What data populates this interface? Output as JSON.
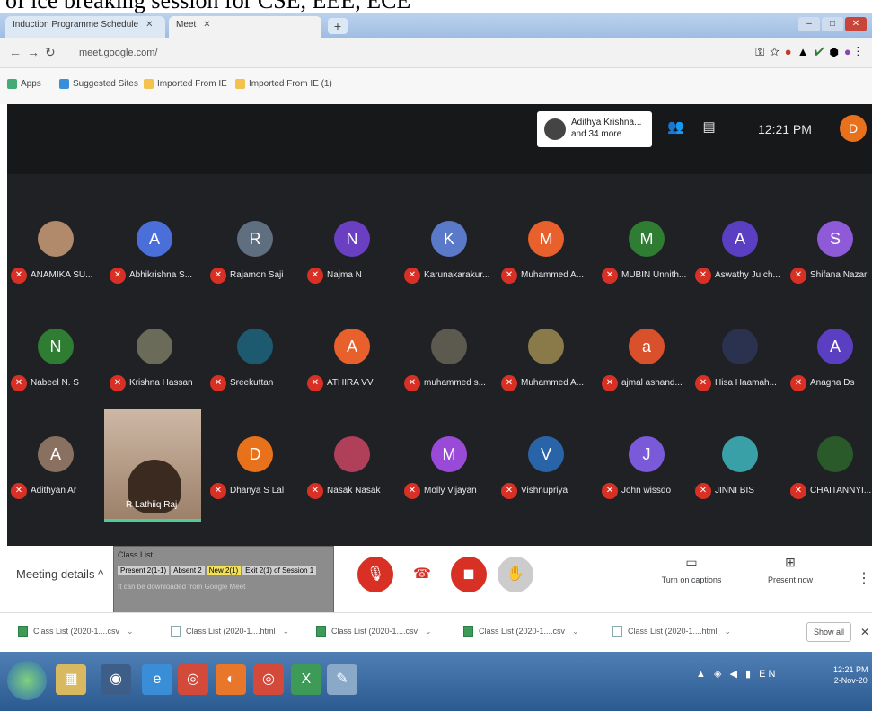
{
  "caption": "of ice breaking session for CSE, EEE, ECE",
  "browser": {
    "tabs": [
      {
        "label": "Induction Programme Schedule",
        "active": false
      },
      {
        "label": "Meet",
        "active": true
      }
    ],
    "address": "meet.google.com/",
    "bookmarks": [
      {
        "label": "Apps",
        "color": "#4a7"
      },
      {
        "label": "Suggested Sites",
        "color": "#3a8ed8"
      },
      {
        "label": "Imported From IE",
        "color": "#f2c14e"
      },
      {
        "label": "Imported From IE (1)",
        "color": "#f2c14e"
      }
    ]
  },
  "meet": {
    "participants_label": "Adithya Krishna... and 34 more",
    "time": "12:21 PM",
    "self_initial": "D",
    "participants": [
      {
        "name": "ANAMIKA SU...",
        "initial": "",
        "color": "#b08a6a",
        "photo": true
      },
      {
        "name": "Abhikrishna S...",
        "initial": "A",
        "color": "#4a6fd8"
      },
      {
        "name": "Rajamon Saji",
        "initial": "R",
        "color": "#5f6f80"
      },
      {
        "name": "Najma N",
        "initial": "N",
        "color": "#6a3fc2"
      },
      {
        "name": "Karunakarakur...",
        "initial": "K",
        "color": "#5a79c8"
      },
      {
        "name": "Muhammed A...",
        "initial": "M",
        "color": "#e8602c"
      },
      {
        "name": "MUBIN Unnith...",
        "initial": "M",
        "color": "#2e7d32"
      },
      {
        "name": "Aswathy Ju.ch...",
        "initial": "A",
        "color": "#5b3fc2"
      },
      {
        "name": "Shifana Nazar",
        "initial": "S",
        "color": "#8e5ad8"
      },
      {
        "name": "Nabeel N. S",
        "initial": "N",
        "color": "#2e7d32"
      },
      {
        "name": "Krishna Hassan",
        "initial": "",
        "color": "#6b6b5a",
        "photo": true
      },
      {
        "name": "Sreekuttan",
        "initial": "",
        "color": "#1d5a70",
        "photo": true
      },
      {
        "name": "ATHIRA VV",
        "initial": "A",
        "color": "#e8602c"
      },
      {
        "name": "muhammed s...",
        "initial": "",
        "color": "#5c5a4e",
        "photo": true
      },
      {
        "name": "Muhammed A...",
        "initial": "",
        "color": "#8a7a4a",
        "photo": true
      },
      {
        "name": "ajmal ashand...",
        "initial": "a",
        "color": "#d8502c"
      },
      {
        "name": "Hisa Haamah...",
        "initial": "",
        "color": "#2a3250",
        "photo": true
      },
      {
        "name": "Anagha Ds",
        "initial": "A",
        "color": "#5b3fc2"
      },
      {
        "name": "Adithyan Ar",
        "initial": "A",
        "color": "#8a7060"
      },
      {
        "name": "Dhanya S Lal",
        "initial": "D",
        "color": "#e8711c"
      },
      {
        "name": "Nasak Nasak",
        "initial": "",
        "color": "#b0405a",
        "photo": true
      },
      {
        "name": "Molly Vijayan",
        "initial": "M",
        "color": "#9a4ad8"
      },
      {
        "name": "Vishnupriya",
        "initial": "V",
        "color": "#2a64a8"
      },
      {
        "name": "John wissdo",
        "initial": "J",
        "color": "#7a5ad8"
      },
      {
        "name": "JINNI BIS",
        "initial": "",
        "color": "#3aa0a8",
        "photo": true
      },
      {
        "name": "CHAITANNYI...",
        "initial": "",
        "color": "#2a5a2a",
        "photo": true
      }
    ],
    "presenter": {
      "name": "R Lathiiq Raj"
    },
    "meeting_details": "Meeting details",
    "preview": {
      "title": "Class List",
      "cells": [
        "Present 2(1-1)",
        "Absent 2",
        "New 2(1)",
        "Exit 2(1) of Session 1"
      ],
      "subtitle": "It can be downloaded from Google Meet"
    },
    "captions_label": "Turn on captions",
    "present_label": "Present now"
  },
  "downloads": [
    {
      "label": "Class List (2020-1....csv",
      "type": "csv"
    },
    {
      "label": "Class List (2020-1....html",
      "type": "html"
    },
    {
      "label": "Class List (2020-1....csv",
      "type": "csv"
    },
    {
      "label": "Class List (2020-1....csv",
      "type": "csv"
    },
    {
      "label": "Class List (2020-1....html",
      "type": "html"
    }
  ],
  "show_all": "Show all",
  "taskbar": {
    "clock_time": "12:21 PM",
    "clock_date": "2-Nov-20"
  }
}
